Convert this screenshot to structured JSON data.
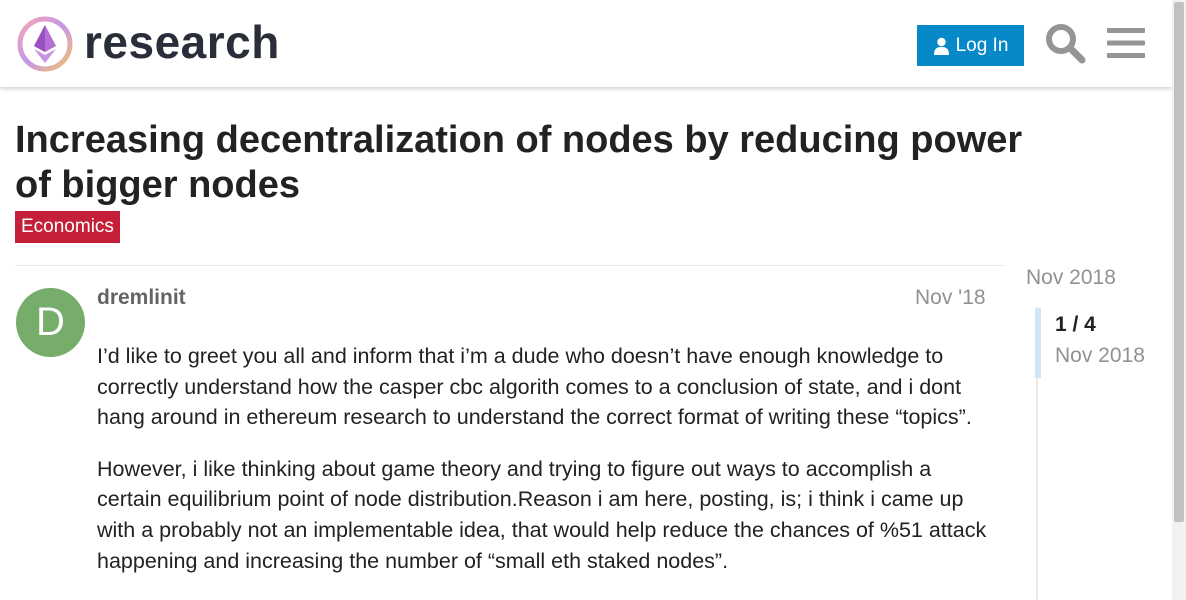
{
  "header": {
    "logo_text": "research",
    "login_label": "Log In",
    "icons": [
      "user-icon",
      "search-icon",
      "hamburger-menu-icon"
    ]
  },
  "topic": {
    "title": "Increasing decentralization of nodes by reducing power of bigger nodes",
    "category": "Economics"
  },
  "post": {
    "avatar_letter": "D",
    "username": "dremlinit",
    "date": "Nov '18",
    "paragraphs": [
      "I’d like to greet you all and inform that i’m a dude who doesn’t have enough knowledge to correctly understand how the casper cbc algorith comes to a conclusion of state, and i dont hang around in ethereum research to understand the correct format of writing these “topics”.",
      "However, i like thinking about game theory and trying to figure out ways to accomplish a certain equilibrium point of node distribution.Reason i am here, posting, is; i think i came up with a probably not an implementable idea, that would help reduce the chances of %51 attack happening and increasing the number of “small eth staked nodes”."
    ]
  },
  "timeline": {
    "start_date": "Nov 2018",
    "position": "1 / 4",
    "position_date": "Nov 2018"
  },
  "colors": {
    "accent": "#0788c8",
    "category": "#c4203a",
    "avatar": "#76ad6b"
  }
}
